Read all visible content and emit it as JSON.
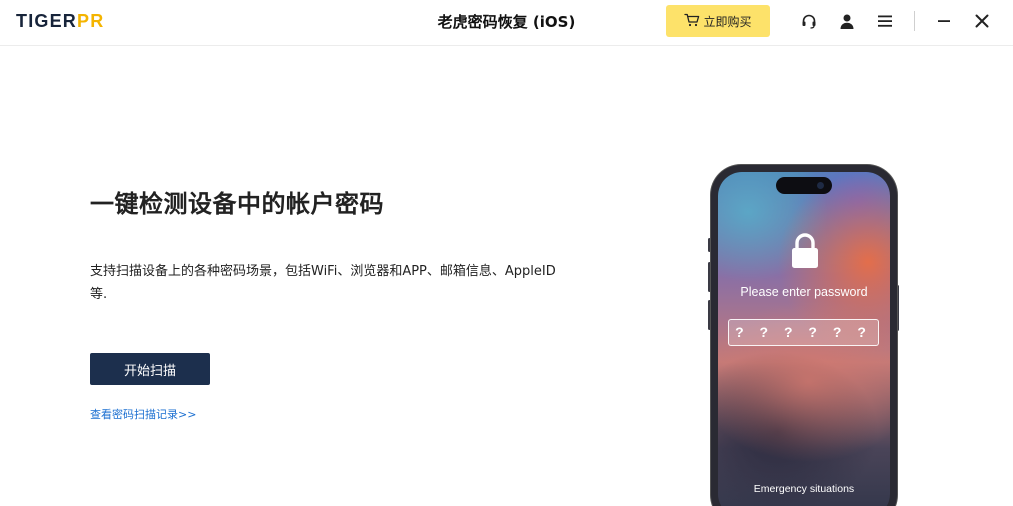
{
  "header": {
    "logo_main": "TIGER",
    "logo_accent": "PR",
    "title": "老虎密码恢复 (iOS)",
    "buy_label": "立即购买",
    "icons": [
      "headset-icon",
      "user-icon",
      "menu-icon",
      "minimize-icon",
      "close-icon"
    ]
  },
  "main": {
    "headline": "一键检测设备中的帐户密码",
    "description": "支持扫描设备上的各种密码场景，包括WiFi、浏览器和APP、邮箱信息、AppleID等.",
    "scan_button": "开始扫描",
    "history_link": "查看密码扫描记录>>"
  },
  "phone": {
    "prompt": "Please enter password",
    "password_placeholder": "? ? ? ? ? ?",
    "emergency": "Emergency situations"
  },
  "colors": {
    "accent_yellow": "#fde26a",
    "logo_accent": "#f4b400",
    "primary_button": "#1c2f4d",
    "link_blue": "#1b6fd1"
  }
}
